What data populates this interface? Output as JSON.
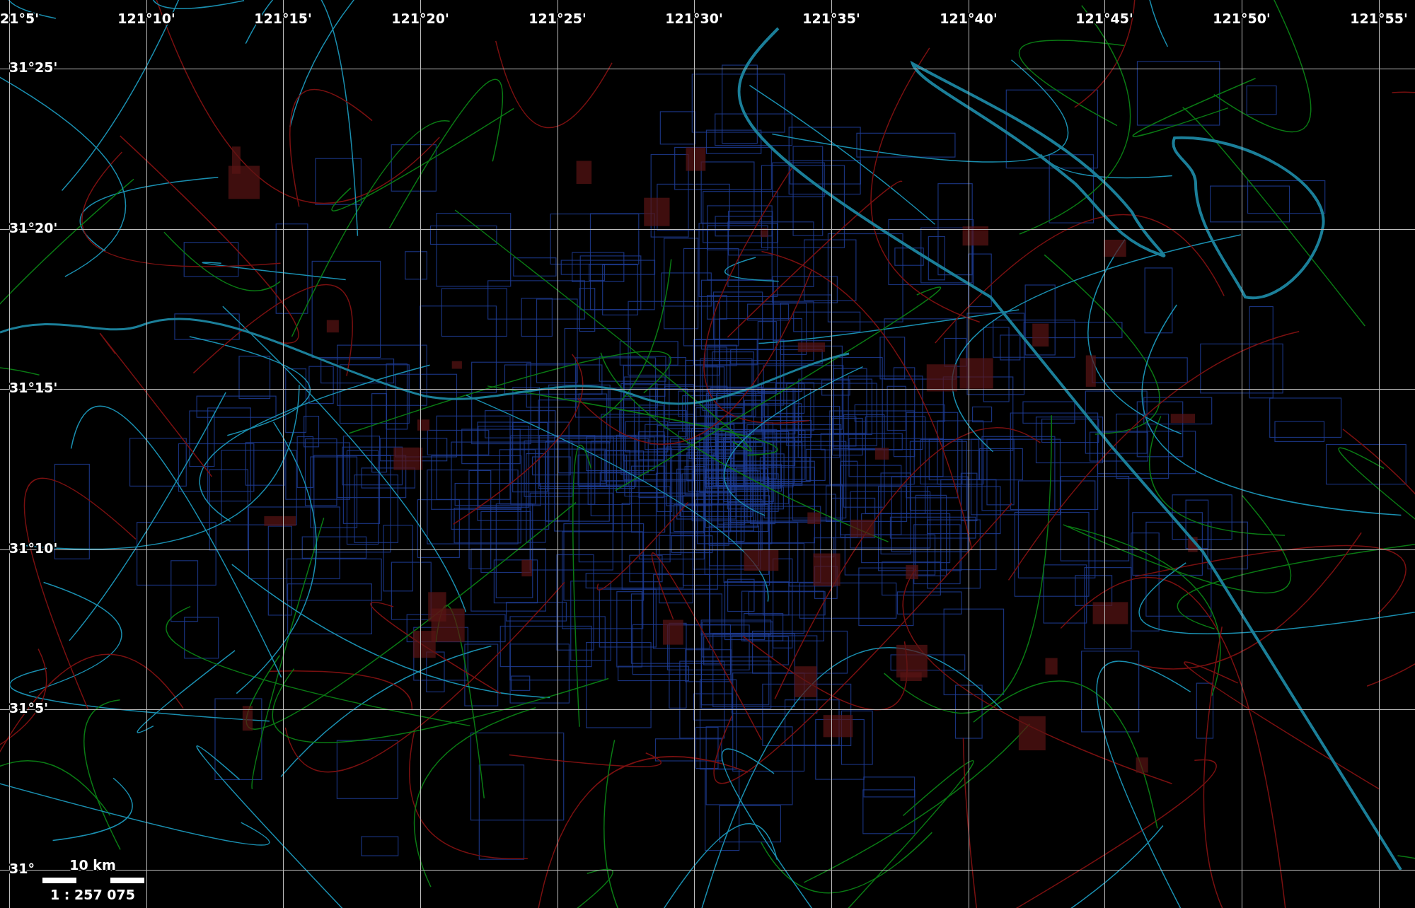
{
  "graticule": {
    "longitude_labels": [
      "21°5'",
      "121°10'",
      "121°15'",
      "121°20'",
      "121°25'",
      "121°30'",
      "121°35'",
      "121°40'",
      "121°45'",
      "121°50'",
      "121°55'"
    ],
    "latitude_labels": [
      "31°25'",
      "31°20'",
      "31°15'",
      "31°10'",
      "31°5'",
      "31°"
    ]
  },
  "scale_bar": {
    "distance": "10 km",
    "ratio": "1 : 257 075"
  }
}
